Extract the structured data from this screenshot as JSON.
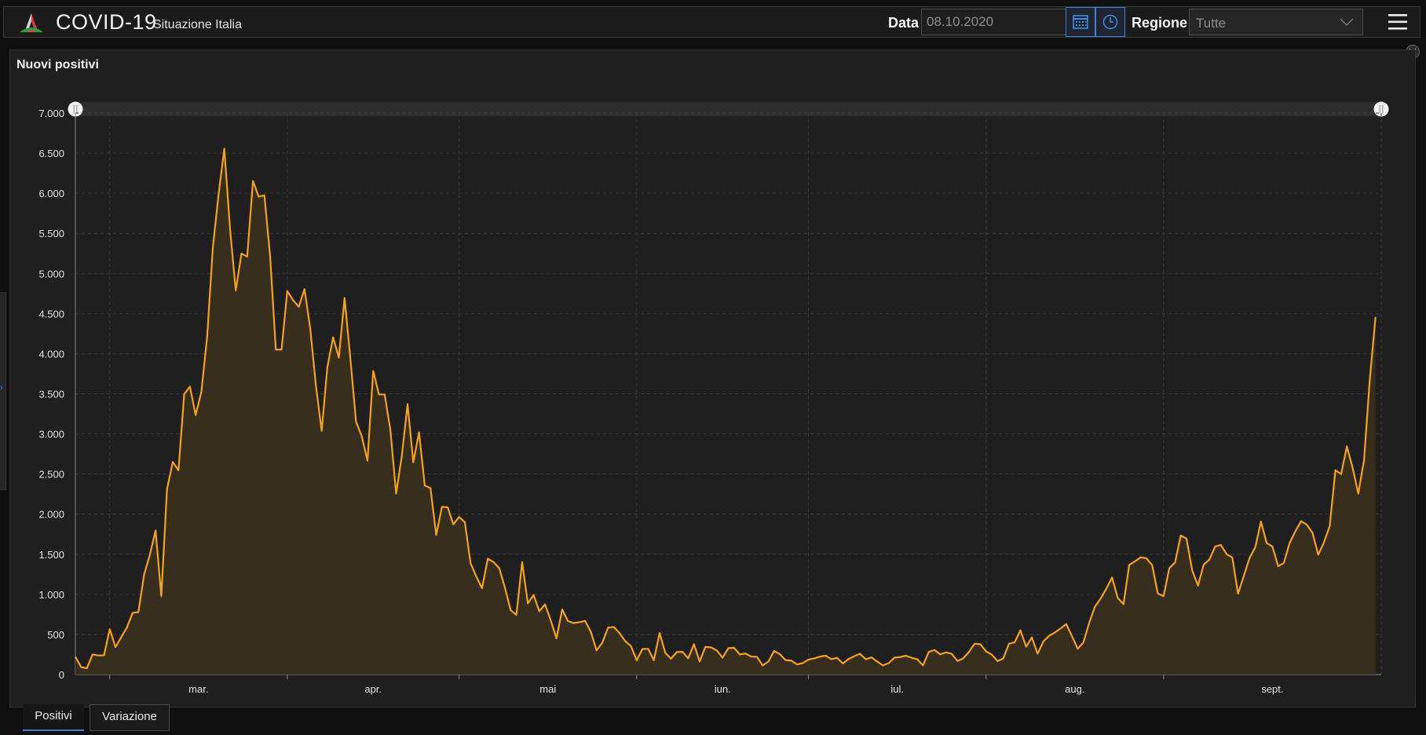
{
  "header": {
    "app_title": "COVID-19",
    "app_subtitle": "Situazione Italia",
    "date_label": "Data",
    "date_value": "08.10.2020",
    "region_label": "Regione",
    "region_value": "Tutte",
    "icons": [
      "italy-logo-icon",
      "calendar-icon",
      "clock-icon",
      "chevron-down-icon",
      "hamburger-menu-icon"
    ]
  },
  "panel": {
    "title": "Nuovi positivi"
  },
  "tabs": [
    {
      "label": "Positivi",
      "active": true
    },
    {
      "label": "Variazione",
      "active": false
    }
  ],
  "colors": {
    "line": "#f5a315",
    "area": "#3a2f1d",
    "background": "#1f1f1f",
    "accent": "#3f7fd8"
  },
  "chart_data": {
    "type": "area",
    "title": "Nuovi positivi",
    "xlabel": "",
    "ylabel": "",
    "ylim": [
      0,
      7000
    ],
    "grid": true,
    "legend": "none",
    "y_ticks": [
      "0",
      "500",
      "1.000",
      "1.500",
      "2.000",
      "2.500",
      "3.000",
      "3.500",
      "4.000",
      "4.500",
      "5.000",
      "5.500",
      "6.000",
      "6.500",
      "7.000"
    ],
    "x_ticks": [
      {
        "label": "mar.",
        "day": 6
      },
      {
        "label": "apr.",
        "day": 37
      },
      {
        "label": "mai",
        "day": 67
      },
      {
        "label": "iun.",
        "day": 98
      },
      {
        "label": "iul.",
        "day": 128
      },
      {
        "label": "aug.",
        "day": 159
      },
      {
        "label": "sept.",
        "day": 190
      }
    ],
    "x_range": [
      0,
      228
    ],
    "series": [
      {
        "values": [
          221,
          93,
          78,
          250,
          238,
          240,
          566,
          342,
          466,
          587,
          769,
          778,
          1247,
          1492,
          1797,
          977,
          2313,
          2651,
          2547,
          3497,
          3590,
          3233,
          3526,
          4207,
          5322,
          5986,
          6557,
          5560,
          4789,
          5249,
          5210,
          6153,
          5959,
          5974,
          5217,
          4050,
          4053,
          4782,
          4668,
          4585,
          4805,
          4316,
          3599,
          3039,
          3836,
          4204,
          3951,
          4694,
          3951,
          3153,
          2972,
          2667,
          3786,
          3493,
          3491,
          3047,
          2256,
          2729,
          3370,
          2646,
          3021,
          2357,
          2324,
          1739,
          2091,
          2086,
          1872,
          1965,
          1900,
          1389,
          1221,
          1075,
          1444,
          1402,
          1327,
          1083,
          802,
          744,
          1402,
          888,
          992,
          789,
          875,
          675,
          451,
          813,
          665,
          642,
          652,
          669,
          531,
          300,
          397,
          584,
          593,
          516,
          416,
          355,
          178,
          318,
          321,
          177,
          518,
          270,
          197,
          280,
          283,
          202,
          379,
          163,
          346,
          338,
          300,
          210,
          329,
          333,
          251,
          262,
          224,
          221,
          113,
          163,
          293,
          255,
          180,
          174,
          126,
          142,
          187,
          201,
          223,
          235,
          192,
          208,
          138,
          193,
          229,
          259,
          190,
          214,
          162,
          114,
          142,
          211,
          218,
          235,
          209,
          190,
          114,
          282,
          306,
          252,
          276,
          259,
          169,
          201,
          280,
          384,
          379,
          289,
          249,
          168,
          199,
          384,
          402,
          552,
          347,
          463,
          259,
          412,
          483,
          523,
          574,
          629,
          479,
          321,
          401,
          642,
          845,
          947,
          1071,
          1210,
          953,
          878,
          1367,
          1411,
          1462,
          1449,
          1365,
          1008,
          978,
          1326,
          1397,
          1733,
          1695,
          1297,
          1108,
          1370,
          1434,
          1597,
          1616,
          1501,
          1460,
          1008,
          1229,
          1452,
          1585,
          1907,
          1638,
          1597,
          1350,
          1392,
          1640,
          1785,
          1912,
          1869,
          1766,
          1494,
          1648,
          1851,
          2548,
          2499,
          2844,
          2578,
          2257,
          2677,
          3678,
          4458
        ]
      }
    ]
  }
}
